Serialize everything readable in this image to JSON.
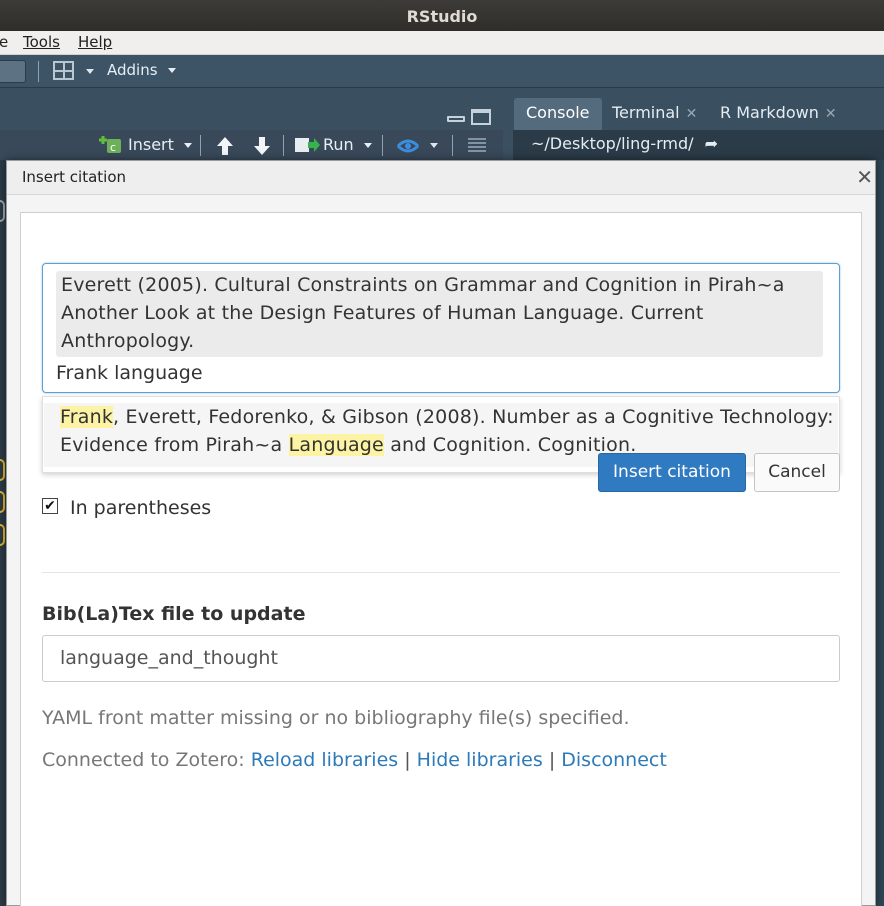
{
  "window": {
    "title": "RStudio"
  },
  "menu": {
    "items": [
      "e",
      "Tools",
      "Help"
    ]
  },
  "toolbar": {
    "addins_label": "Addins"
  },
  "editor_toolbar": {
    "insert_label": "Insert",
    "run_label": "Run"
  },
  "right_pane": {
    "tabs": [
      {
        "label": "Console"
      },
      {
        "label": "Terminal"
      },
      {
        "label": "R Markdown"
      }
    ],
    "path": "~/Desktop/ling-rmd/"
  },
  "dialog": {
    "title": "Insert citation",
    "selected_citation": "Everett (2005). Cultural Constraints on Grammar and Cognition in Pirah~a Another Look at the Design Features of Human Language. Current Anthropology.",
    "search_value": "Frank language",
    "suggestion": {
      "hl1": "Frank",
      "part1": ", Everett, Fedorenko, & Gibson (2008). Number as a Cognitive Technology: Evidence from Pirah~a ",
      "hl2": "Language",
      "part2": " and Cognition. Cognition."
    },
    "in_parentheses_label": "In parentheses",
    "in_parentheses_checked": true,
    "insert_button": "Insert citation",
    "cancel_button": "Cancel",
    "bib_label": "Bib(La)Tex file to update",
    "bib_value": "language_and_thought",
    "yaml_message": "YAML front matter missing or no bibliography file(s) specified.",
    "zotero": {
      "prefix": "Connected to Zotero:",
      "reload": "Reload libraries",
      "hide": "Hide libraries",
      "disconnect": "Disconnect",
      "separator": "|"
    }
  },
  "colors": {
    "accent": "#2f7ac0",
    "link": "#2d7ab9",
    "highlight": "#fcf3a5",
    "titlebar": "#3c3b37"
  }
}
